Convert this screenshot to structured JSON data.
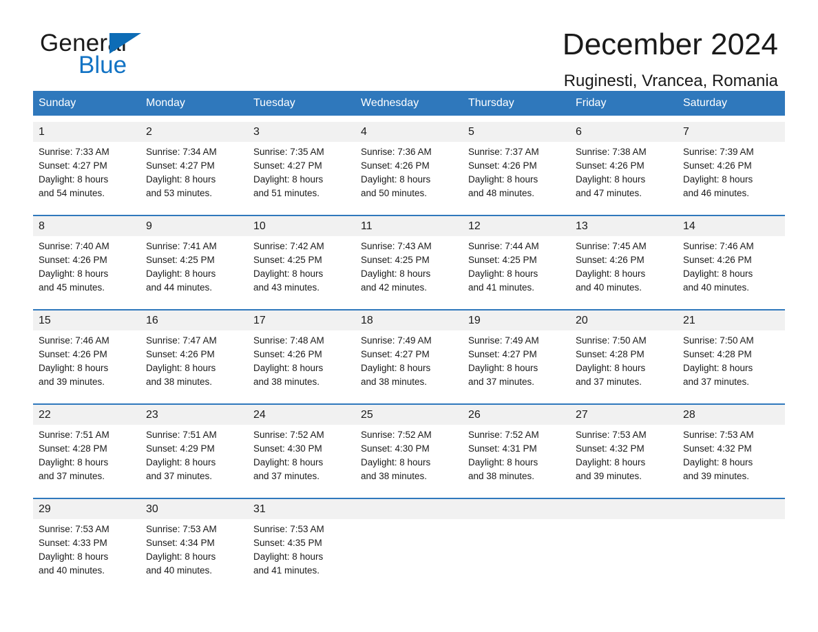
{
  "brand": {
    "name_part1": "General",
    "name_part2": "Blue",
    "logo_icon": "triangle-flag-icon",
    "accent_color": "#1273c4"
  },
  "header": {
    "month_title": "December 2024",
    "location": "Ruginesti, Vrancea, Romania"
  },
  "calendar": {
    "header_bg": "#2f78bc",
    "daynum_bg": "#f1f1f1",
    "weekday_headers": [
      "Sunday",
      "Monday",
      "Tuesday",
      "Wednesday",
      "Thursday",
      "Friday",
      "Saturday"
    ],
    "weeks": [
      [
        {
          "day": "1",
          "sunrise": "Sunrise: 7:33 AM",
          "sunset": "Sunset: 4:27 PM",
          "daylight1": "Daylight: 8 hours",
          "daylight2": "and 54 minutes."
        },
        {
          "day": "2",
          "sunrise": "Sunrise: 7:34 AM",
          "sunset": "Sunset: 4:27 PM",
          "daylight1": "Daylight: 8 hours",
          "daylight2": "and 53 minutes."
        },
        {
          "day": "3",
          "sunrise": "Sunrise: 7:35 AM",
          "sunset": "Sunset: 4:27 PM",
          "daylight1": "Daylight: 8 hours",
          "daylight2": "and 51 minutes."
        },
        {
          "day": "4",
          "sunrise": "Sunrise: 7:36 AM",
          "sunset": "Sunset: 4:26 PM",
          "daylight1": "Daylight: 8 hours",
          "daylight2": "and 50 minutes."
        },
        {
          "day": "5",
          "sunrise": "Sunrise: 7:37 AM",
          "sunset": "Sunset: 4:26 PM",
          "daylight1": "Daylight: 8 hours",
          "daylight2": "and 48 minutes."
        },
        {
          "day": "6",
          "sunrise": "Sunrise: 7:38 AM",
          "sunset": "Sunset: 4:26 PM",
          "daylight1": "Daylight: 8 hours",
          "daylight2": "and 47 minutes."
        },
        {
          "day": "7",
          "sunrise": "Sunrise: 7:39 AM",
          "sunset": "Sunset: 4:26 PM",
          "daylight1": "Daylight: 8 hours",
          "daylight2": "and 46 minutes."
        }
      ],
      [
        {
          "day": "8",
          "sunrise": "Sunrise: 7:40 AM",
          "sunset": "Sunset: 4:26 PM",
          "daylight1": "Daylight: 8 hours",
          "daylight2": "and 45 minutes."
        },
        {
          "day": "9",
          "sunrise": "Sunrise: 7:41 AM",
          "sunset": "Sunset: 4:25 PM",
          "daylight1": "Daylight: 8 hours",
          "daylight2": "and 44 minutes."
        },
        {
          "day": "10",
          "sunrise": "Sunrise: 7:42 AM",
          "sunset": "Sunset: 4:25 PM",
          "daylight1": "Daylight: 8 hours",
          "daylight2": "and 43 minutes."
        },
        {
          "day": "11",
          "sunrise": "Sunrise: 7:43 AM",
          "sunset": "Sunset: 4:25 PM",
          "daylight1": "Daylight: 8 hours",
          "daylight2": "and 42 minutes."
        },
        {
          "day": "12",
          "sunrise": "Sunrise: 7:44 AM",
          "sunset": "Sunset: 4:25 PM",
          "daylight1": "Daylight: 8 hours",
          "daylight2": "and 41 minutes."
        },
        {
          "day": "13",
          "sunrise": "Sunrise: 7:45 AM",
          "sunset": "Sunset: 4:26 PM",
          "daylight1": "Daylight: 8 hours",
          "daylight2": "and 40 minutes."
        },
        {
          "day": "14",
          "sunrise": "Sunrise: 7:46 AM",
          "sunset": "Sunset: 4:26 PM",
          "daylight1": "Daylight: 8 hours",
          "daylight2": "and 40 minutes."
        }
      ],
      [
        {
          "day": "15",
          "sunrise": "Sunrise: 7:46 AM",
          "sunset": "Sunset: 4:26 PM",
          "daylight1": "Daylight: 8 hours",
          "daylight2": "and 39 minutes."
        },
        {
          "day": "16",
          "sunrise": "Sunrise: 7:47 AM",
          "sunset": "Sunset: 4:26 PM",
          "daylight1": "Daylight: 8 hours",
          "daylight2": "and 38 minutes."
        },
        {
          "day": "17",
          "sunrise": "Sunrise: 7:48 AM",
          "sunset": "Sunset: 4:26 PM",
          "daylight1": "Daylight: 8 hours",
          "daylight2": "and 38 minutes."
        },
        {
          "day": "18",
          "sunrise": "Sunrise: 7:49 AM",
          "sunset": "Sunset: 4:27 PM",
          "daylight1": "Daylight: 8 hours",
          "daylight2": "and 38 minutes."
        },
        {
          "day": "19",
          "sunrise": "Sunrise: 7:49 AM",
          "sunset": "Sunset: 4:27 PM",
          "daylight1": "Daylight: 8 hours",
          "daylight2": "and 37 minutes."
        },
        {
          "day": "20",
          "sunrise": "Sunrise: 7:50 AM",
          "sunset": "Sunset: 4:28 PM",
          "daylight1": "Daylight: 8 hours",
          "daylight2": "and 37 minutes."
        },
        {
          "day": "21",
          "sunrise": "Sunrise: 7:50 AM",
          "sunset": "Sunset: 4:28 PM",
          "daylight1": "Daylight: 8 hours",
          "daylight2": "and 37 minutes."
        }
      ],
      [
        {
          "day": "22",
          "sunrise": "Sunrise: 7:51 AM",
          "sunset": "Sunset: 4:28 PM",
          "daylight1": "Daylight: 8 hours",
          "daylight2": "and 37 minutes."
        },
        {
          "day": "23",
          "sunrise": "Sunrise: 7:51 AM",
          "sunset": "Sunset: 4:29 PM",
          "daylight1": "Daylight: 8 hours",
          "daylight2": "and 37 minutes."
        },
        {
          "day": "24",
          "sunrise": "Sunrise: 7:52 AM",
          "sunset": "Sunset: 4:30 PM",
          "daylight1": "Daylight: 8 hours",
          "daylight2": "and 37 minutes."
        },
        {
          "day": "25",
          "sunrise": "Sunrise: 7:52 AM",
          "sunset": "Sunset: 4:30 PM",
          "daylight1": "Daylight: 8 hours",
          "daylight2": "and 38 minutes."
        },
        {
          "day": "26",
          "sunrise": "Sunrise: 7:52 AM",
          "sunset": "Sunset: 4:31 PM",
          "daylight1": "Daylight: 8 hours",
          "daylight2": "and 38 minutes."
        },
        {
          "day": "27",
          "sunrise": "Sunrise: 7:53 AM",
          "sunset": "Sunset: 4:32 PM",
          "daylight1": "Daylight: 8 hours",
          "daylight2": "and 39 minutes."
        },
        {
          "day": "28",
          "sunrise": "Sunrise: 7:53 AM",
          "sunset": "Sunset: 4:32 PM",
          "daylight1": "Daylight: 8 hours",
          "daylight2": "and 39 minutes."
        }
      ],
      [
        {
          "day": "29",
          "sunrise": "Sunrise: 7:53 AM",
          "sunset": "Sunset: 4:33 PM",
          "daylight1": "Daylight: 8 hours",
          "daylight2": "and 40 minutes."
        },
        {
          "day": "30",
          "sunrise": "Sunrise: 7:53 AM",
          "sunset": "Sunset: 4:34 PM",
          "daylight1": "Daylight: 8 hours",
          "daylight2": "and 40 minutes."
        },
        {
          "day": "31",
          "sunrise": "Sunrise: 7:53 AM",
          "sunset": "Sunset: 4:35 PM",
          "daylight1": "Daylight: 8 hours",
          "daylight2": "and 41 minutes."
        },
        {
          "day": "",
          "sunrise": "",
          "sunset": "",
          "daylight1": "",
          "daylight2": ""
        },
        {
          "day": "",
          "sunrise": "",
          "sunset": "",
          "daylight1": "",
          "daylight2": ""
        },
        {
          "day": "",
          "sunrise": "",
          "sunset": "",
          "daylight1": "",
          "daylight2": ""
        },
        {
          "day": "",
          "sunrise": "",
          "sunset": "",
          "daylight1": "",
          "daylight2": ""
        }
      ]
    ]
  }
}
